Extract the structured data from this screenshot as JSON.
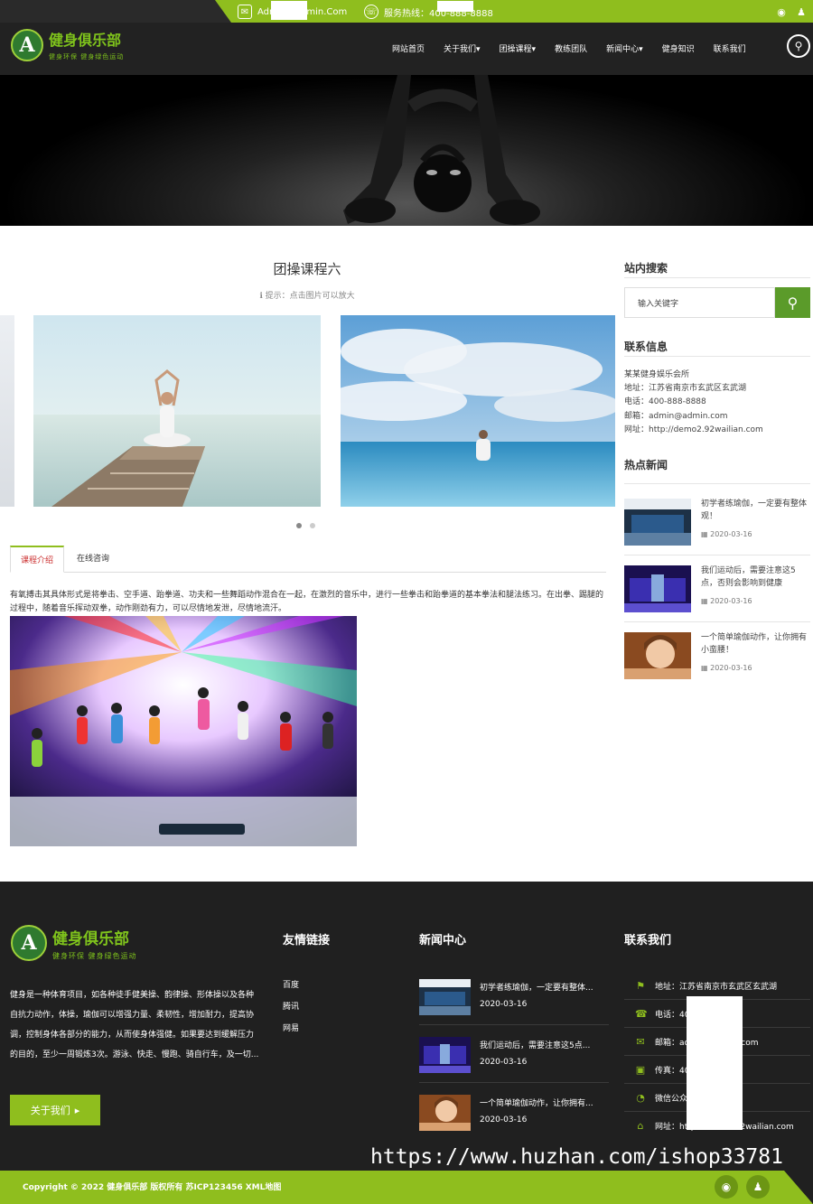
{
  "topbar": {
    "email": "Admin@admin.Com",
    "hotline": "服务热线：400-888-8888"
  },
  "header": {
    "logo_title": "健身俱乐部",
    "logo_sub": "健身环保 健身绿色运动",
    "logo_letter": "A",
    "nav": [
      "网站首页",
      "关于我们▾",
      "团操课程▾",
      "教练团队",
      "新闻中心▾",
      "健身知识",
      "联系我们"
    ]
  },
  "main": {
    "title": "团操课程六",
    "hint": "提示：点击图片可以放大",
    "tabs": [
      "课程介绍",
      "在线咨询"
    ],
    "description": "有氧搏击其具体形式是将拳击、空手道、跆拳道、功夫和一些舞蹈动作混合在一起，在激烈的音乐中，进行一些拳击和跆拳道的基本拳法和腿法练习。在出拳、踢腿的过程中，随着音乐挥动双拳，动作刚劲有力，可以尽情地发泄，尽情地流汗。"
  },
  "sidebar": {
    "search_title": "站内搜索",
    "search_placeholder": "输入关键字",
    "contact_title": "联系信息",
    "contact_lines": [
      "某某健身娱乐会所",
      "地址：江苏省南京市玄武区玄武湖",
      "电话：400-888-8888",
      "邮箱：admin@admin.com",
      "网址：http://demo2.92wailian.com"
    ],
    "hot_title": "热点新闻",
    "hot_news": [
      {
        "title": "初学者练瑜伽，一定要有整体观！",
        "date": "2020-03-16"
      },
      {
        "title": "我们运动后，需要注意这5点，否则会影响到健康",
        "date": "2020-03-16"
      },
      {
        "title": "一个简单瑜伽动作，让你拥有小蛮腰！",
        "date": "2020-03-16"
      }
    ]
  },
  "footer": {
    "logo_title": "健身俱乐部",
    "logo_sub": "健身环保 健身绿色运动",
    "about_text": "健身是一种体育项目，如各种徒手健美操、韵律操、形体操以及各种自抗力动作，体操，瑜伽可以增强力量、柔韧性，增加耐力，提高协调，控制身体各部分的能力，从而使身体强健。如果要达到缓解压力的目的，至少一周锻炼3次。游泳、快走、慢跑、骑自行车，及一切...",
    "about_button": "关于我们",
    "links_title": "友情链接",
    "links": [
      "百度",
      "腾讯",
      "网易"
    ],
    "news_title": "新闻中心",
    "news": [
      {
        "title": "初学者练瑜伽，一定要有整体...",
        "date": "2020-03-16"
      },
      {
        "title": "我们运动后，需要注意这5点...",
        "date": "2020-03-16"
      },
      {
        "title": "一个简单瑜伽动作，让你拥有...",
        "date": "2020-03-16"
      }
    ],
    "contact_title": "联系我们",
    "contacts": [
      {
        "icon": "location-icon",
        "text": "地址：江苏省南京市玄武区玄武湖"
      },
      {
        "icon": "phone-icon",
        "text": "电话：400-888-8888"
      },
      {
        "icon": "mail-icon",
        "text": "邮箱：admin@admin.com"
      },
      {
        "icon": "fax-icon",
        "text": "传真：400-888-8888"
      },
      {
        "icon": "wechat-icon",
        "text": "微信公众号：admin"
      },
      {
        "icon": "home-icon",
        "text": "网址：http://demo2.92wailian.com"
      }
    ],
    "watermark": "https://www.huzhan.com/ishop33781",
    "copyright": "Copyright © 2022 健身俱乐部 版权所有 苏ICP123456 XML地图"
  },
  "colors": {
    "accent": "#8fbe1e",
    "dark": "#222222",
    "footer": "#202020"
  }
}
